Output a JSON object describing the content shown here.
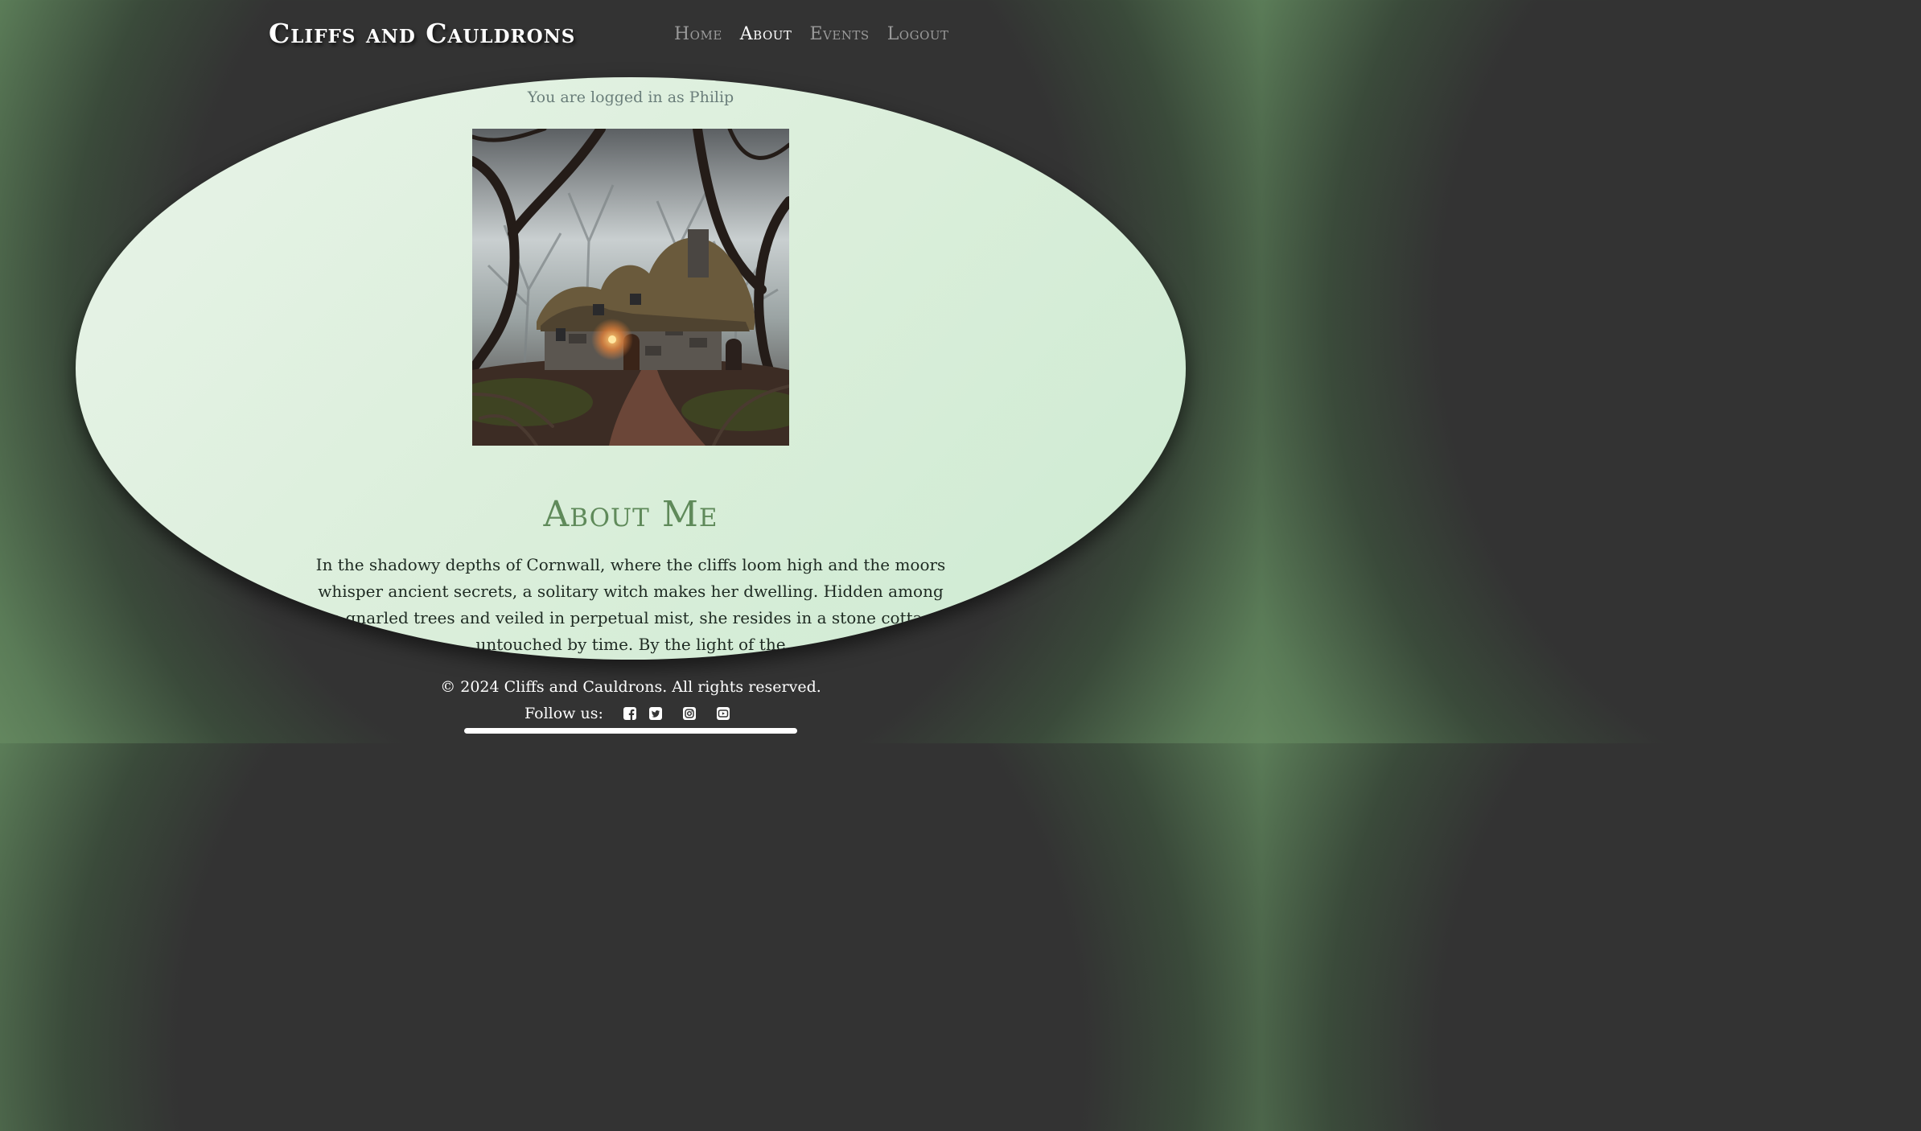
{
  "header": {
    "site_title": "Cliffs and Cauldrons",
    "nav": [
      {
        "label": "Home",
        "active": false
      },
      {
        "label": "About",
        "active": true
      },
      {
        "label": "Events",
        "active": false
      },
      {
        "label": "Logout",
        "active": false
      }
    ]
  },
  "main": {
    "login_status": "You are logged in as Philip",
    "image_icon": "witch-cottage-image",
    "heading": "About Me",
    "body_text": "In the shadowy depths of Cornwall, where the cliffs loom high and the moors whisper ancient secrets, a solitary witch makes her dwelling. Hidden among the gnarled trees and veiled in perpetual mist, she resides in a stone cottage, untouched by time. By the light of the"
  },
  "footer": {
    "copyright": "© 2024 Cliffs and Cauldrons. All rights reserved.",
    "follow_label": "Follow us:",
    "social": [
      {
        "icon": "facebook-icon"
      },
      {
        "icon": "twitter-icon"
      },
      {
        "icon": "instagram-icon"
      },
      {
        "icon": "youtube-icon"
      }
    ]
  },
  "colors": {
    "background": "#333333",
    "accent_green": "#5f8a5a",
    "oval_bg": "#daeeda"
  }
}
